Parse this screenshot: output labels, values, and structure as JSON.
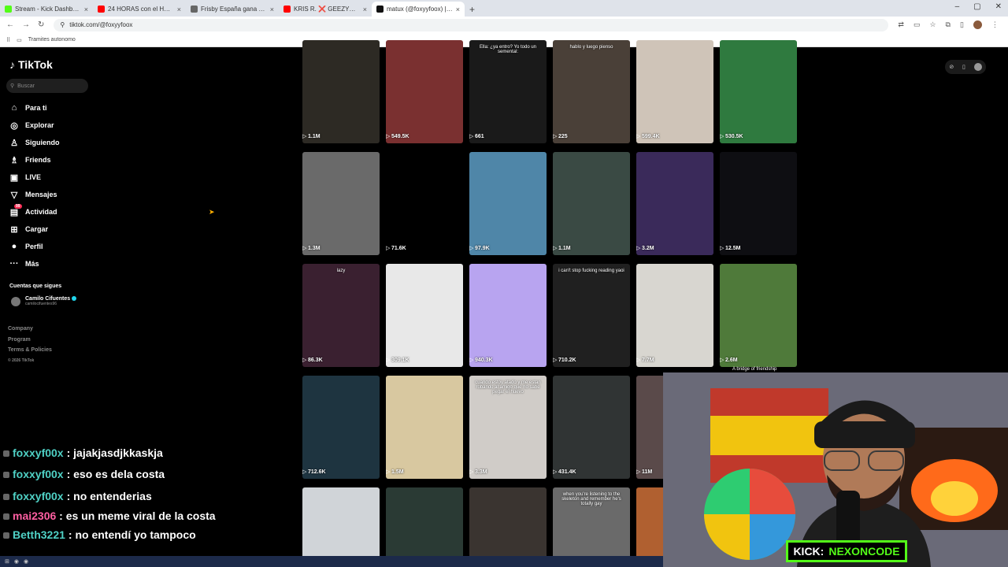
{
  "browser": {
    "tabs": [
      {
        "title": "Stream - Kick Dashboard",
        "color": "#53fc18"
      },
      {
        "title": "24 HORAS con el HOMBRE MÁS...",
        "color": "#ff0000"
      },
      {
        "title": "Frisby España gana una batalla...",
        "color": "#666666"
      },
      {
        "title": "KRIS R. ❌ GEEZYDEE - BOBADA...",
        "color": "#ff0000"
      },
      {
        "title": "matux (@foxyyfoox) | TikTok",
        "color": "#111111"
      }
    ],
    "new_tab": "+",
    "url": "tiktok.com/@foxyyfoox",
    "bookmark": "Tramites autonomo"
  },
  "tiktok": {
    "logo": "TikTok",
    "search_placeholder": "Buscar",
    "menu": [
      {
        "icon": "⌂",
        "label": "Para ti"
      },
      {
        "icon": "◎",
        "label": "Explorar"
      },
      {
        "icon": "♙",
        "label": "Siguiendo"
      },
      {
        "icon": "♗",
        "label": "Friends"
      },
      {
        "icon": "▣",
        "label": "LIVE"
      },
      {
        "icon": "▽",
        "label": "Mensajes"
      },
      {
        "icon": "▤",
        "label": "Actividad",
        "badge": "99"
      },
      {
        "icon": "⊞",
        "label": "Cargar"
      },
      {
        "icon": "●",
        "label": "Perfil"
      },
      {
        "icon": "···",
        "label": "Más"
      }
    ],
    "following_header": "Cuentas que sigues",
    "following": [
      {
        "name": "Camilo Cifuentes",
        "user": "camilocifuentes96"
      }
    ],
    "footer": [
      "Company",
      "Program",
      "Terms & Policies",
      "© 2026 TikTok"
    ],
    "overflow_caption": "A bridge of friendship",
    "videos": [
      {
        "views": "1.1M",
        "color": "#2d2a24",
        "caption": ""
      },
      {
        "views": "549.5K",
        "color": "#7a3030",
        "caption": ""
      },
      {
        "views": "661",
        "color": "#1a1a1a",
        "caption": "Ella: ¿ya entro? Yo todo un semental:"
      },
      {
        "views": "225",
        "color": "#4a4038",
        "caption": "hablo y luego pienso"
      },
      {
        "views": "599.4K",
        "color": "#cfc4b8",
        "caption": ""
      },
      {
        "views": "530.5K",
        "color": "#2f7a3f",
        "caption": ""
      },
      {
        "views": "1.3M",
        "color": "#6a6a6a",
        "caption": ""
      },
      {
        "views": "71.6K",
        "color": "#000000",
        "caption": ""
      },
      {
        "views": "97.9K",
        "color": "#4f86a8",
        "caption": ""
      },
      {
        "views": "1.1M",
        "color": "#3a4a44",
        "caption": ""
      },
      {
        "views": "3.2M",
        "color": "#3a2a5a",
        "caption": ""
      },
      {
        "views": "12.5M",
        "color": "#0e0e12",
        "caption": ""
      },
      {
        "views": "86.3K",
        "color": "#3a2030",
        "caption": "lazy"
      },
      {
        "views": "309.1K",
        "color": "#e8e8e8",
        "caption": ""
      },
      {
        "views": "940.3K",
        "color": "#b8a4f0",
        "caption": ""
      },
      {
        "views": "710.2K",
        "color": "#202020",
        "caption": "i can't stop fucking reading yaoi"
      },
      {
        "views": "7.7M",
        "color": "#d8d6d0",
        "caption": ""
      },
      {
        "views": "2.6M",
        "color": "#4f7a3a",
        "caption": ""
      },
      {
        "views": "712.6K",
        "color": "#1e3440",
        "caption": ""
      },
      {
        "views": "1.5M",
        "color": "#d8c8a0",
        "caption": ""
      },
      {
        "views": "3.3M",
        "color": "#d0ccc8",
        "caption": "cuando estoy atado y me estan robando al amigo que no sabe pegar el huevo"
      },
      {
        "views": "431.4K",
        "color": "#303434",
        "caption": ""
      },
      {
        "views": "11M",
        "color": "#5a4a4a",
        "caption": ""
      },
      {
        "views": "",
        "color": "#5a6060",
        "caption": ""
      },
      {
        "views": "",
        "color": "#d0d4d8",
        "caption": ""
      },
      {
        "views": "",
        "color": "#2a3a34",
        "caption": ""
      },
      {
        "views": "",
        "color": "#3a3430",
        "caption": ""
      },
      {
        "views": "",
        "color": "#6a6a6a",
        "caption": "when you're listening to the skeleton and remember he's totally gay"
      },
      {
        "views": "",
        "color": "#b06030",
        "caption": ""
      }
    ]
  },
  "chat": [
    {
      "user": "foxxyf00x",
      "text": ": jajakjasdjkkaskja",
      "pink": false
    },
    {
      "user": "foxxyf00x",
      "text": ": eso es dela costa",
      "pink": false
    },
    {
      "user": "foxxyf00x",
      "text": ": no entenderias",
      "pink": false
    },
    {
      "user": "mai2306",
      "text": ": es un meme viral de la costa",
      "pink": true
    },
    {
      "user": "Betth3221",
      "text": ": no entendí yo tampoco",
      "pink": false
    }
  ],
  "kick": {
    "label": "KICK:",
    "name": "NEXONCODE"
  },
  "colors": {
    "accent": "#fe2c55",
    "kick": "#53fc18"
  }
}
